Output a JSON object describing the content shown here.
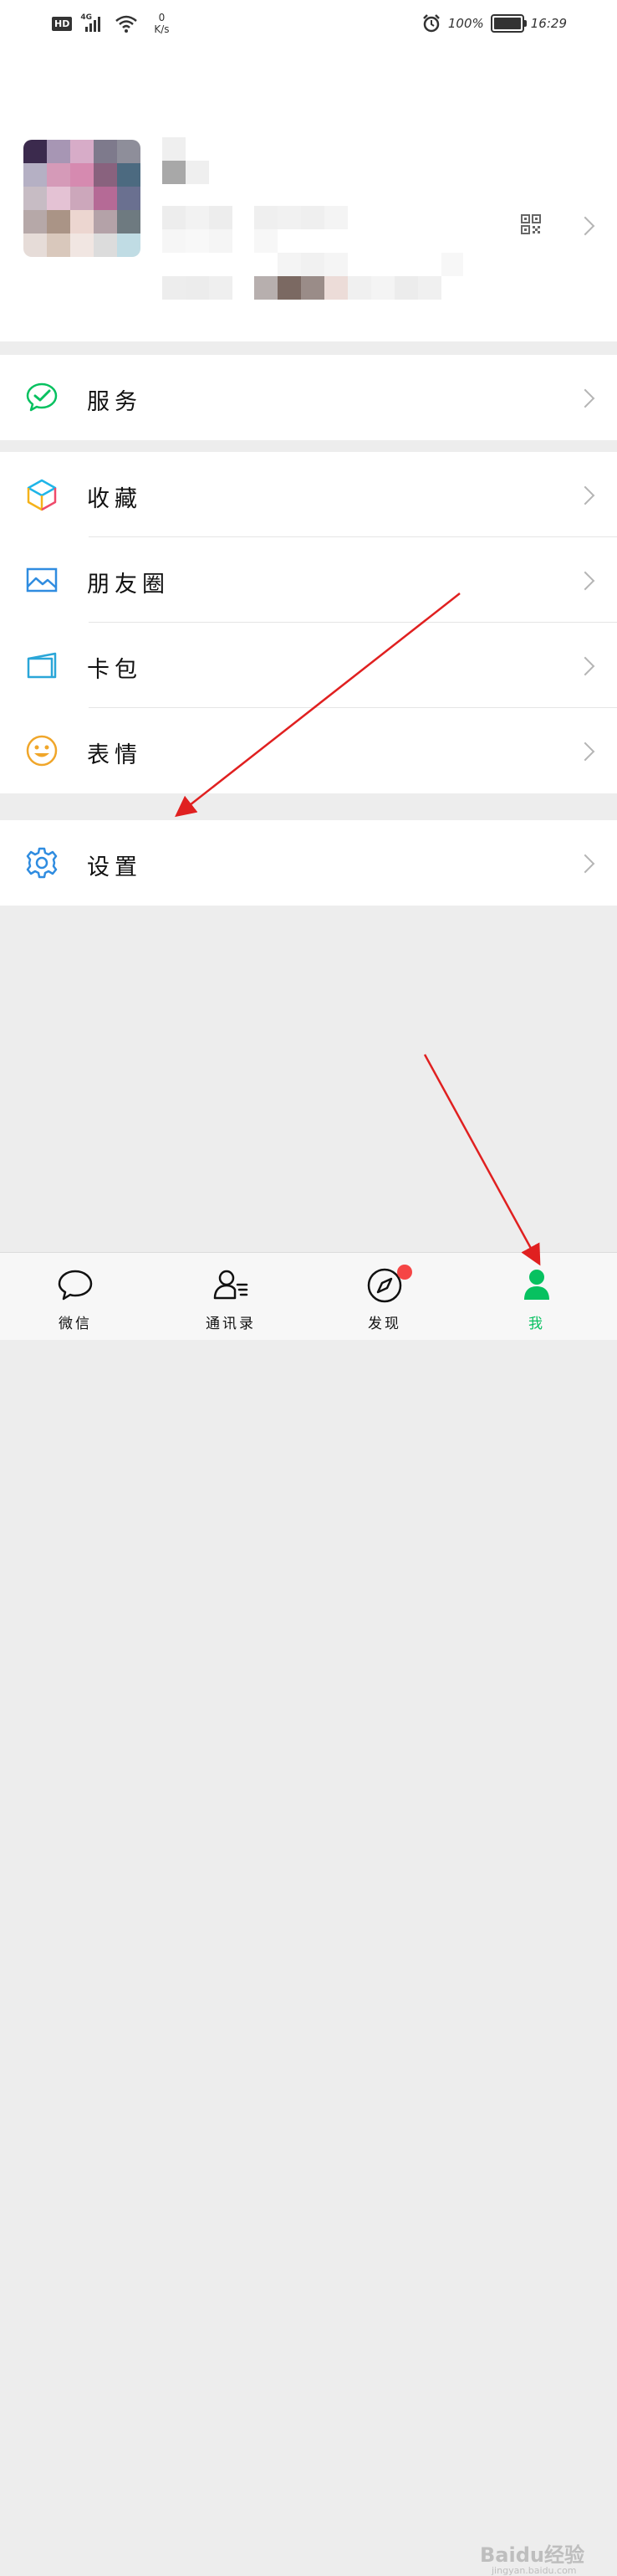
{
  "status_bar": {
    "hd": "HD",
    "network": "4G",
    "speed_value": "0",
    "speed_unit": "K/s",
    "battery": "100%",
    "time": "16:29"
  },
  "menu": {
    "service": "服务",
    "favorites": "收藏",
    "moments": "朋友圈",
    "cards": "卡包",
    "stickers": "表情",
    "settings": "设置"
  },
  "tabs": [
    {
      "label": "微信"
    },
    {
      "label": "通讯录"
    },
    {
      "label": "发现"
    },
    {
      "label": "我"
    }
  ],
  "colors": {
    "accent": "#07c160",
    "badge": "#f54545",
    "annotation_arrow": "#e02020"
  },
  "watermark": {
    "text": "Baidu经验",
    "url": "jingyan.baidu.com"
  }
}
